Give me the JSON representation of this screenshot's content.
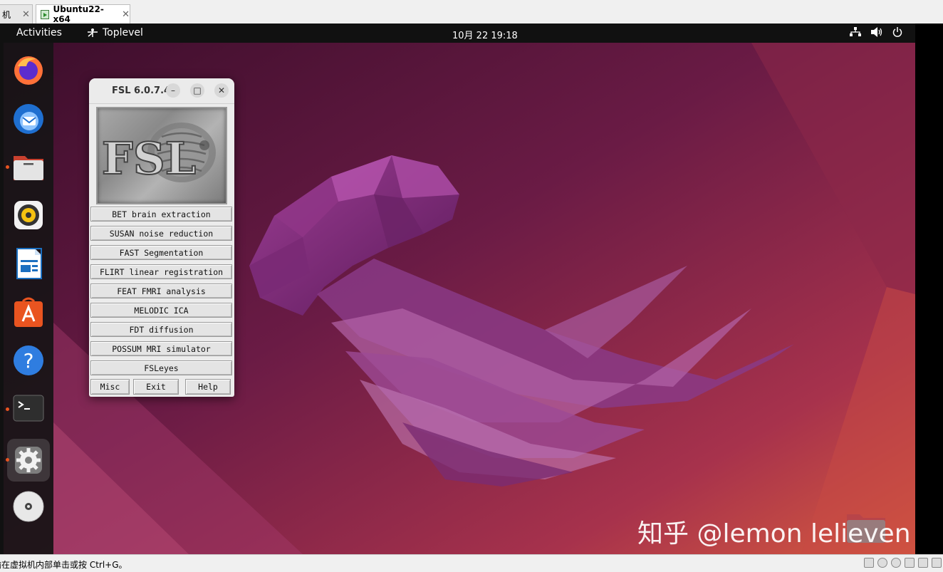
{
  "host_tabs": [
    {
      "label": "机",
      "close": "✕"
    },
    {
      "label": "Ubuntu22-x64",
      "close": "✕"
    }
  ],
  "topbar": {
    "activities": "Activities",
    "toplevel": "Toplevel",
    "clock": "10月 22  19:18"
  },
  "dock_items": [
    "firefox-icon",
    "thunderbird-icon",
    "files-icon",
    "rhythmbox-icon",
    "libreoffice-writer-icon",
    "app-center-icon",
    "help-icon",
    "terminal-icon",
    "settings-icon",
    "dvd-icon"
  ],
  "fsl": {
    "title": "FSL 6.0.7.4",
    "logo_text": "FSL",
    "buttons": [
      "BET brain extraction",
      "SUSAN noise reduction",
      "FAST Segmentation",
      "FLIRT linear registration",
      "FEAT FMRI analysis",
      "MELODIC ICA",
      "FDT diffusion",
      "POSSUM MRI simulator",
      "FSLeyes"
    ],
    "misc": "Misc",
    "exit": "Exit",
    "help": "Help"
  },
  "watermark": "知乎 @lemon lelieven",
  "status": {
    "message": "输在虚拟机内部单击或按 Ctrl+G。"
  },
  "colors": {
    "accent": "#e95420",
    "wallpaper_dark": "#3a0d2a",
    "wallpaper_mid": "#7a1f4c",
    "wallpaper_warm": "#c4404a"
  }
}
